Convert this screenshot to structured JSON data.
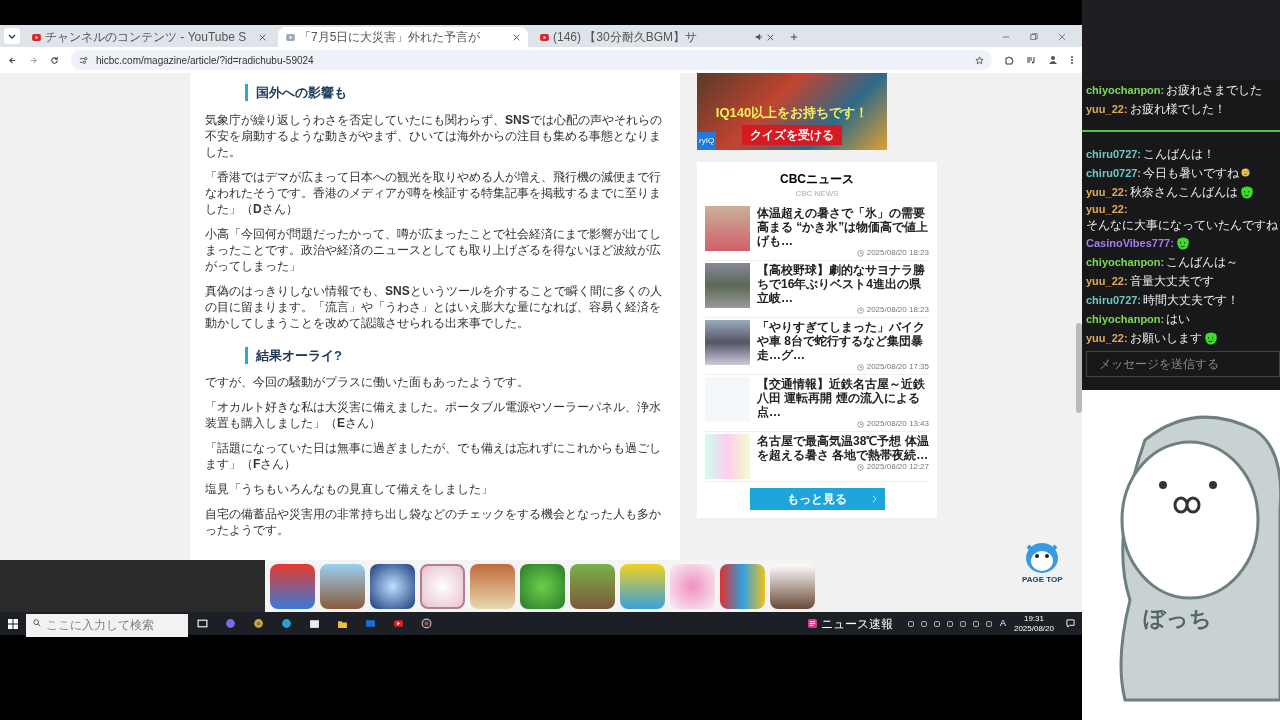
{
  "browser": {
    "tabs": [
      {
        "title": "チャンネルのコンテンツ - YouTube S",
        "selected": false,
        "audio": false
      },
      {
        "title": "「7月5日に大災害」外れた予言が",
        "selected": true,
        "audio": false
      },
      {
        "title": "(146) 【30分耐久BGM】サ",
        "selected": false,
        "audio": true
      }
    ],
    "url": "hicbc.com/magazine/article/?id=radichubu-59024"
  },
  "article": {
    "sections": [
      {
        "heading": "国外への影響も",
        "paragraphs": [
          "気象庁が繰り返しうわさを否定していたにも関わらず、**SNS**では心配の声やそれらの不安を扇動するような動きがやまず、ひいては海外からの注目も集める事態となりました。",
          "「香港ではデマが広まって日本への観光を取りやめる人が増え、飛行機の減便まで行なわれたそうです。香港のメディアが噂を検証する特集記事を掲載するまでに至りました」（**D**さん）",
          "小高「今回何が問題だったかって、噂が広まったことで社会経済にまで影響が出てしまったことです。政治や経済のニュースとしても取り上げざるを得ないほど波紋が広がってしまった」",
          "真偽のはっきりしない情報でも、**SNS**というツールを介することで瞬く間に多くの人の目に留まります。「流言」や「うわさ」とはいえ膨大な量になれば、容易く経済を動かしてしまうことを改めて認識させられる出来事でした。"
        ]
      },
      {
        "heading": "結果オーライ?",
        "paragraphs": [
          "ですが、今回の騒動がプラスに働いた面もあったようです。",
          "「オカルト好きな私は大災害に備えました。ポータブル電源やソーラーパネル、浄水装置も購入しました」（**E**さん）",
          "「話題になっていた日は無事に過ぎましたが、でも備えは忘れずにこれからも過ごします」（**F**さん）",
          "塩見「うちもいろんなもの見直して備えをしました」",
          "自宅の備蓄品や災害用の非常持ち出し袋などのチェックをする機会となった人も多かったようです。"
        ]
      }
    ]
  },
  "ad": {
    "headline": "IQ140以上をお持ちです！",
    "button": "クイズを受ける",
    "logo": "ryIQ"
  },
  "news": {
    "title": "CBCニュース",
    "subtitle": "CBC NEWS",
    "items": [
      {
        "title": "体温超えの暑さで「氷」の需要高まる “かき氷”は物価高で値上げも…",
        "date": "2025/08/20 18:23"
      },
      {
        "title": "【高校野球】劇的なサヨナラ勝ちで16年ぶりベスト4進出の県立岐…",
        "date": "2025/08/20 18:23"
      },
      {
        "title": "「やりすぎてしまった」バイクや車 8台で蛇行するなど集団暴走…グ…",
        "date": "2025/08/20 17:35"
      },
      {
        "title": "【交通情報】近鉄名古屋～近鉄八田 運転再開 煙の流入による点…",
        "date": "2025/08/20 13:43"
      },
      {
        "title": "名古屋で最高気温38℃予想 体温を超える暑さ 各地で熱帯夜続…",
        "date": "2025/08/20 12:27"
      }
    ],
    "more_button": "もっと見る"
  },
  "page_top": "PAGE TOP",
  "chat": {
    "messages": [
      {
        "kind": "message",
        "user": "chiyochanpon:",
        "color": "#7ed957",
        "text": "お疲れさまでした"
      },
      {
        "kind": "message",
        "user": "yuu_22:",
        "color": "#e0a85a",
        "text": "お疲れ様でした！"
      },
      {
        "kind": "divider"
      },
      {
        "kind": "message",
        "user": "chiru0727:",
        "color": "#6cc9c0",
        "text": "こんばんは！"
      },
      {
        "kind": "message",
        "user": "chiru0727:",
        "color": "#6cc9c0",
        "text": "今日も暑いですね",
        "emoji": true
      },
      {
        "kind": "message",
        "user": "yuu_22:",
        "color": "#e0a85a",
        "text": "秋奈さんこんばんは",
        "emote": true
      },
      {
        "kind": "message",
        "user": "yuu_22:",
        "color": "#e0a85a",
        "text": "そんなに大事になっていたんですね"
      },
      {
        "kind": "message",
        "user": "CasinoVibes777:",
        "color": "#a97ae8",
        "emote": true
      },
      {
        "kind": "message",
        "user": "chiyochanpon:",
        "color": "#7ed957",
        "text": "こんばんは～"
      },
      {
        "kind": "message",
        "user": "yuu_22:",
        "color": "#e0a85a",
        "text": "音量大丈夫です"
      },
      {
        "kind": "message",
        "user": "chiru0727:",
        "color": "#6cc9c0",
        "text": "時間大丈夫です！"
      },
      {
        "kind": "message",
        "user": "chiyochanpon:",
        "color": "#7ed957",
        "text": "はい"
      },
      {
        "kind": "message",
        "user": "yuu_22:",
        "color": "#e0a85a",
        "text": "お願いします",
        "emote": true
      }
    ],
    "input_placeholder": "メッセージを送信する"
  },
  "taskbar": {
    "search_placeholder": "ここに入力して検索",
    "news": "ニュース速報",
    "ime": "A",
    "time": "19:31",
    "date": "2025/08/20"
  },
  "mascot": {
    "label": "ぼっち"
  }
}
